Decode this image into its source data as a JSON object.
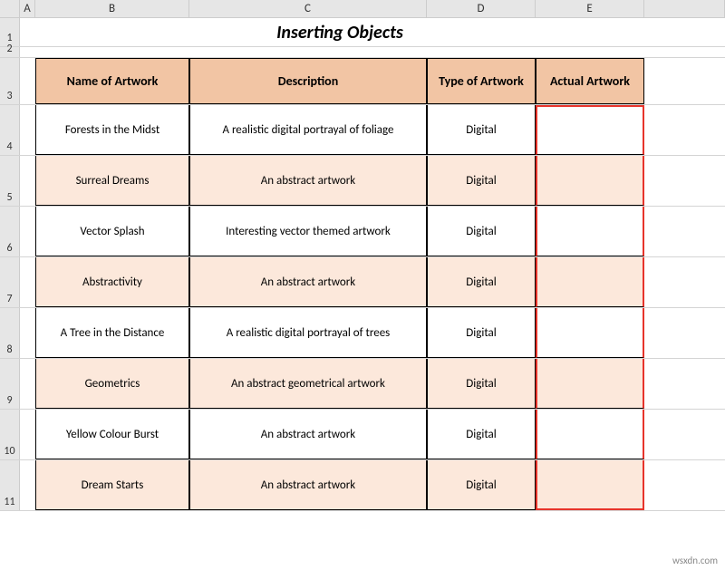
{
  "columns": {
    "A": "A",
    "B": "B",
    "C": "C",
    "D": "D",
    "E": "E"
  },
  "rowLabels": {
    "r1": "1",
    "r2": "2",
    "r3": "3",
    "r4": "4",
    "r5": "5",
    "r6": "6",
    "r7": "7",
    "r8": "8",
    "r9": "9",
    "r10": "10",
    "r11": "11"
  },
  "title": "Inserting Objects",
  "headers": {
    "name": "Name of Artwork",
    "description": "Description",
    "type": "Type of Artwork",
    "actual": "Actual Artwork"
  },
  "rows": [
    {
      "name": "Forests in the Midst",
      "description": "A realistic digital portrayal of  foliage",
      "type": "Digital",
      "actual": ""
    },
    {
      "name": "Surreal Dreams",
      "description": "An abstract artwork",
      "type": "Digital",
      "actual": ""
    },
    {
      "name": "Vector Splash",
      "description": "Interesting vector themed artwork",
      "type": "Digital",
      "actual": ""
    },
    {
      "name": "Abstractivity",
      "description": "An abstract artwork",
      "type": "Digital",
      "actual": ""
    },
    {
      "name": "A Tree in the Distance",
      "description": "A realistic digital portrayal of trees",
      "type": "Digital",
      "actual": ""
    },
    {
      "name": "Geometrics",
      "description": "An abstract geometrical artwork",
      "type": "Digital",
      "actual": ""
    },
    {
      "name": "Yellow Colour Burst",
      "description": "An abstract artwork",
      "type": "Digital",
      "actual": ""
    },
    {
      "name": "Dream Starts",
      "description": "An abstract artwork",
      "type": "Digital",
      "actual": ""
    }
  ],
  "watermark": "wsxdn.com"
}
